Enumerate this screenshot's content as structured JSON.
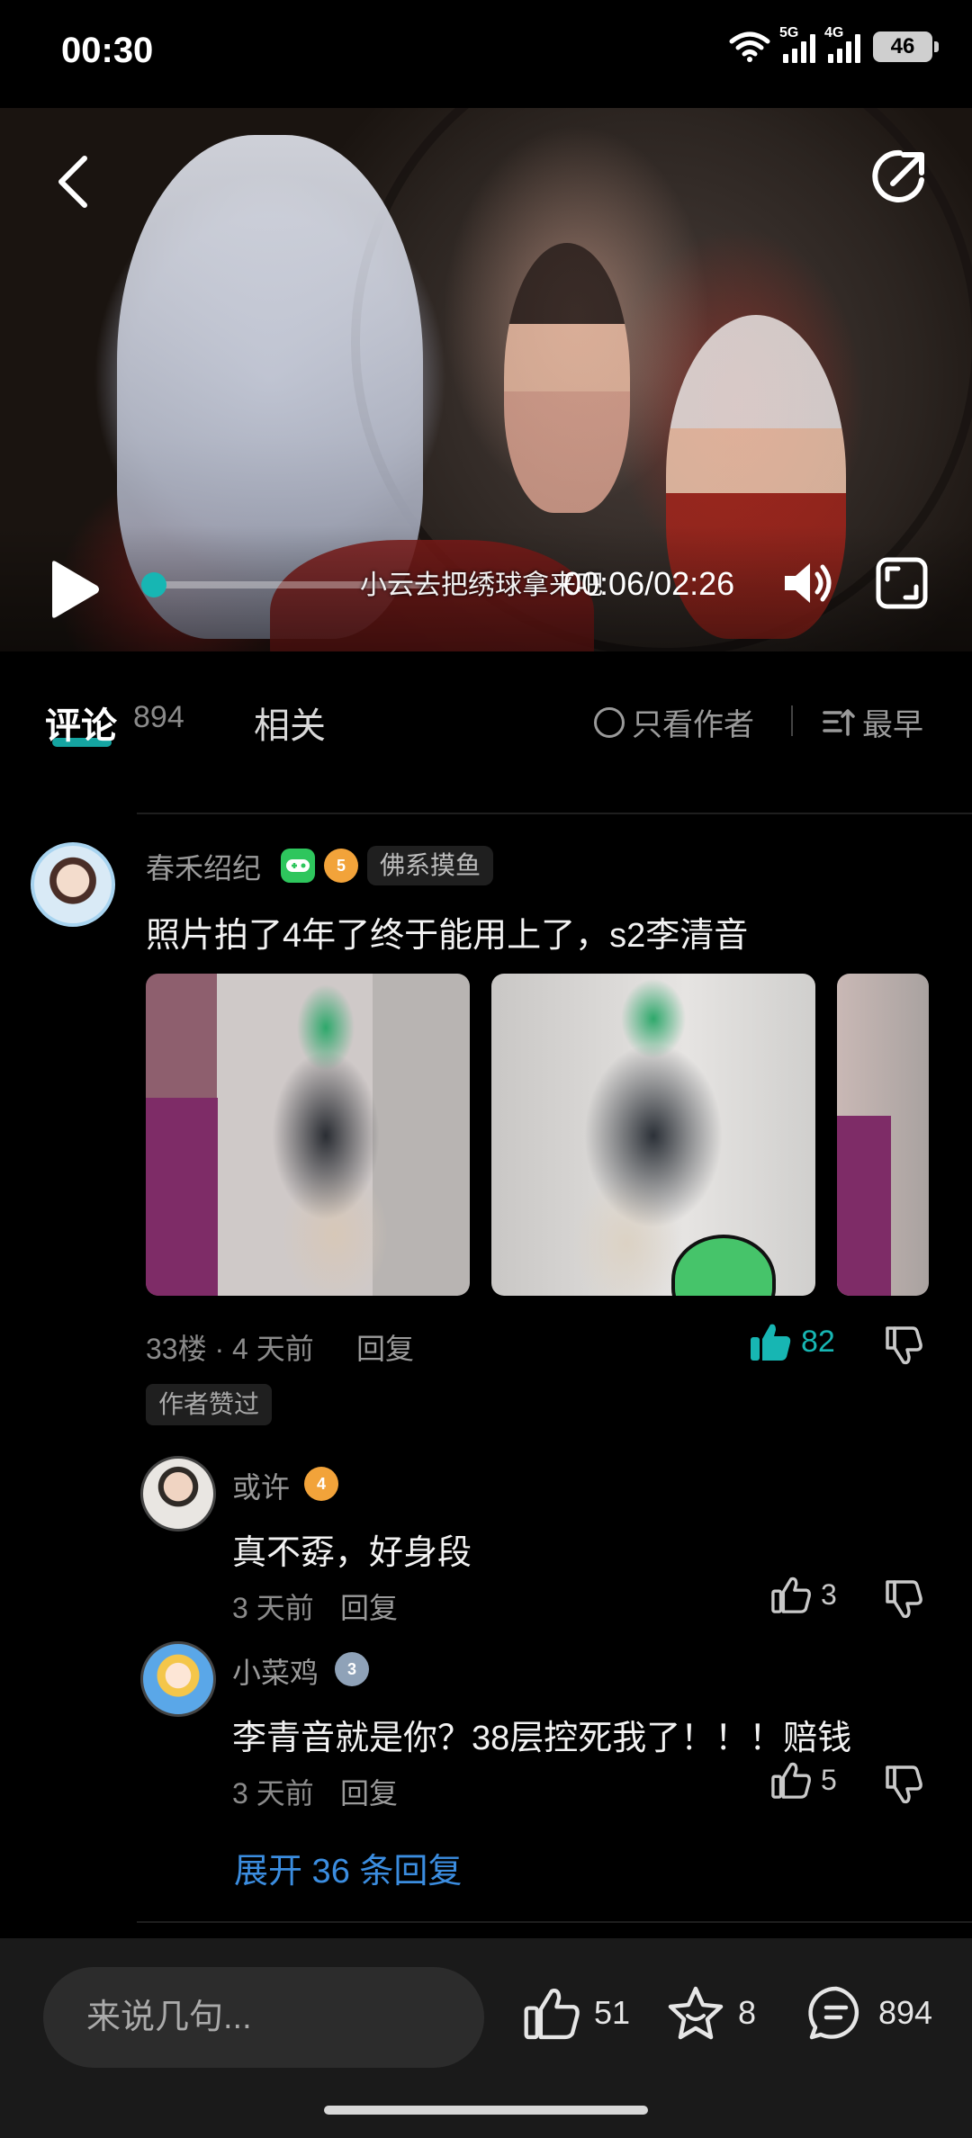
{
  "status_bar": {
    "time": "00:30",
    "battery": "46",
    "net1": "5G",
    "net2": "4G"
  },
  "video": {
    "subtitle": "小云去把绣球拿来吧",
    "time_display": "00:06/02:26",
    "progress_fraction": 0.04,
    "accent_color": "#17b6b3"
  },
  "tabs": {
    "comments_label": "评论",
    "comments_count": "894",
    "related_label": "相关",
    "author_only_label": "只看作者",
    "sort_label": "最早"
  },
  "comment": {
    "username": "春禾绍纪",
    "level_badge": "5",
    "tag": "佛系摸鱼",
    "text": "照片拍了4年了终于能用上了，s2李清音",
    "floor_time": "33楼 · 4 天前",
    "reply_label": "回复",
    "likes": "82",
    "author_liked": "作者赞过"
  },
  "replies": [
    {
      "username": "或许",
      "level_badge": "4",
      "text": "真不孬，好身段",
      "time": "3 天前",
      "reply_label": "回复",
      "likes": "3"
    },
    {
      "username": "小菜鸡",
      "level_badge": "3",
      "text": "李青音就是你？38层控死我了！！！赔钱",
      "time": "3 天前",
      "reply_label": "回复",
      "likes": "5"
    }
  ],
  "expand_label": "展开 36 条回复",
  "bottom_bar": {
    "input_placeholder": "来说几句...",
    "like_count": "51",
    "favorite_count": "8",
    "comment_count": "894"
  }
}
